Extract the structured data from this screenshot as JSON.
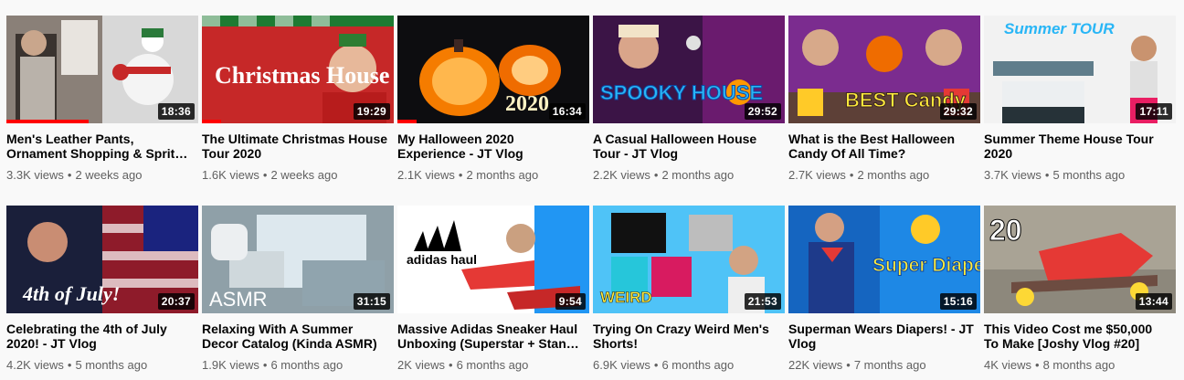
{
  "videos": [
    {
      "title": "Men's Leather Pants, Ornament Shopping & Sprit…",
      "duration": "18:36",
      "views": "3.3K views",
      "age": "2 weeks ago",
      "watched": 0.43,
      "thumb_text": ""
    },
    {
      "title": "The Ultimate Christmas House Tour 2020",
      "duration": "19:29",
      "views": "1.6K views",
      "age": "2 weeks ago",
      "watched": 0.1,
      "thumb_text": "Christmas House Tour"
    },
    {
      "title": "My Halloween 2020 Experience - JT Vlog",
      "duration": "16:34",
      "views": "2.1K views",
      "age": "2 months ago",
      "watched": 0.1,
      "thumb_text": "2020"
    },
    {
      "title": "A Casual Halloween House Tour - JT Vlog",
      "duration": "29:52",
      "views": "2.2K views",
      "age": "2 months ago",
      "watched": 0,
      "thumb_text": "SPOOKY HOUSE"
    },
    {
      "title": "What is the Best Halloween Candy Of All Time?",
      "duration": "29:32",
      "views": "2.7K views",
      "age": "2 months ago",
      "watched": 0,
      "thumb_text": "BEST Candy"
    },
    {
      "title": "Summer Theme House Tour 2020",
      "duration": "17:11",
      "views": "3.7K views",
      "age": "5 months ago",
      "watched": 0,
      "thumb_text": "Summer TOUR"
    },
    {
      "title": "Celebrating the 4th of July 2020! - JT Vlog",
      "duration": "20:37",
      "views": "4.2K views",
      "age": "5 months ago",
      "watched": 0,
      "thumb_text": "4th of July!"
    },
    {
      "title": "Relaxing With A Summer Decor Catalog (Kinda ASMR)",
      "duration": "31:15",
      "views": "1.9K views",
      "age": "6 months ago",
      "watched": 0,
      "thumb_text": "ASMR"
    },
    {
      "title": "Massive Adidas Sneaker Haul Unboxing (Superstar + Stan…",
      "duration": "9:54",
      "views": "2K views",
      "age": "6 months ago",
      "watched": 0,
      "thumb_text": "adidas haul"
    },
    {
      "title": "Trying On Crazy Weird Men's Shorts!",
      "duration": "21:53",
      "views": "6.9K views",
      "age": "6 months ago",
      "watched": 0,
      "thumb_text": "WEIRD"
    },
    {
      "title": "Superman Wears Diapers! - JT Vlog",
      "duration": "15:16",
      "views": "22K views",
      "age": "7 months ago",
      "watched": 0,
      "thumb_text": "Super Diapers!"
    },
    {
      "title": "This Video Cost me $50,000 To Make [Joshy Vlog #20]",
      "duration": "13:44",
      "views": "4K views",
      "age": "8 months ago",
      "watched": 0,
      "thumb_text": "20"
    }
  ],
  "separator": "•",
  "colors": {
    "progress": "#ff0000",
    "title": "#030303",
    "meta": "#606060",
    "background": "#f9f9f9"
  }
}
